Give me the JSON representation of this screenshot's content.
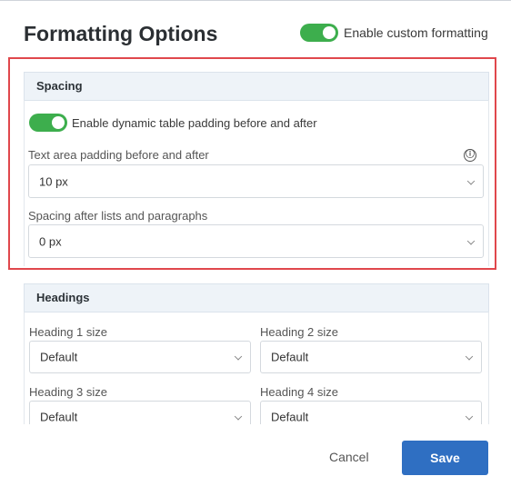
{
  "dialog": {
    "title": "Formatting Options",
    "custom_formatting_label": "Enable custom formatting",
    "custom_formatting_on": true
  },
  "spacing": {
    "header": "Spacing",
    "dynamic_padding_label": "Enable dynamic table padding before and after",
    "dynamic_padding_on": true,
    "text_padding_label": "Text area padding before and after",
    "text_padding_value": "10 px",
    "after_lists_label": "Spacing after lists and paragraphs",
    "after_lists_value": "0 px",
    "info_icon": "ⓘ"
  },
  "headings": {
    "header": "Headings",
    "fields": [
      {
        "label": "Heading 1 size",
        "value": "Default"
      },
      {
        "label": "Heading 2 size",
        "value": "Default"
      },
      {
        "label": "Heading 3 size",
        "value": "Default"
      },
      {
        "label": "Heading 4 size",
        "value": "Default"
      }
    ]
  },
  "footer": {
    "cancel_label": "Cancel",
    "save_label": "Save"
  },
  "colors": {
    "accent": "#2f6fc2",
    "toggle_on": "#3dae4d",
    "highlight": "#e0474c"
  }
}
